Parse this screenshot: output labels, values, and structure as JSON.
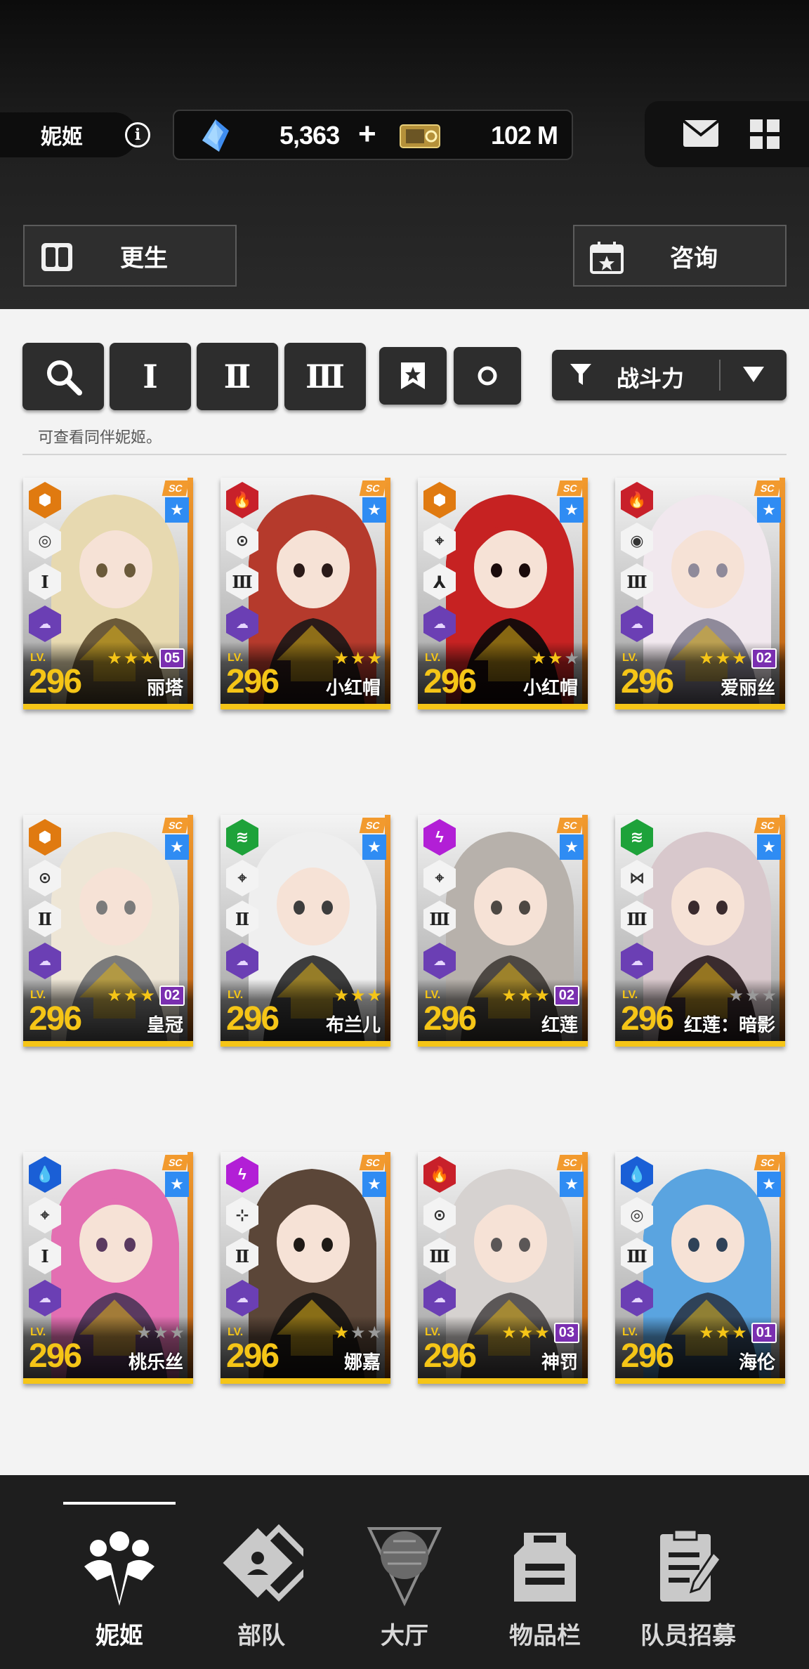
{
  "header": {
    "player_name": "妮姬",
    "info_icon": "info-icon",
    "gem_amount": "5,363",
    "gem_plus": "+",
    "credit_amount": "102 M",
    "mail_icon": "mail-icon",
    "menu_icon": "grid-icon"
  },
  "actions": {
    "rebirth_label": "更生",
    "consult_label": "咨询"
  },
  "filters": {
    "search_icon": "search-icon",
    "burst_1": "Ⅰ",
    "burst_2": "Ⅱ",
    "burst_3": "Ⅲ",
    "favorite_icon": "bookmark-star-icon",
    "circle_icon": "circle-icon",
    "sort_label": "战斗力",
    "hint": "可查看同伴妮姬。"
  },
  "lv_label": "LV.",
  "cards": [
    {
      "name": "丽塔",
      "level": "296",
      "element": "iron",
      "element_color": "#e07a10",
      "burst": "Ⅰ",
      "stars": 3,
      "limit_break": "05"
    },
    {
      "name": "小红帽",
      "level": "296",
      "element": "fire",
      "element_color": "#c8202a",
      "burst": "Ⅲ",
      "stars": 3,
      "limit_break": ""
    },
    {
      "name": "小红帽",
      "level": "296",
      "element": "iron",
      "element_color": "#e07a10",
      "burst": "⅄",
      "stars": 2,
      "limit_break": ""
    },
    {
      "name": "爱丽丝",
      "level": "296",
      "element": "fire",
      "element_color": "#c8202a",
      "burst": "Ⅲ",
      "stars": 3,
      "limit_break": "02"
    },
    {
      "name": "皇冠",
      "level": "296",
      "element": "iron",
      "element_color": "#e07a10",
      "burst": "Ⅱ",
      "stars": 3,
      "limit_break": "02"
    },
    {
      "name": "布兰儿",
      "level": "296",
      "element": "wind",
      "element_color": "#1ea23a",
      "burst": "Ⅱ",
      "stars": 3,
      "limit_break": ""
    },
    {
      "name": "红莲",
      "level": "296",
      "element": "electric",
      "element_color": "#b21fd6",
      "burst": "Ⅲ",
      "stars": 3,
      "limit_break": "02"
    },
    {
      "name": "红莲：暗影",
      "level": "296",
      "element": "wind",
      "element_color": "#1ea23a",
      "burst": "Ⅲ",
      "stars": 0,
      "limit_break": ""
    },
    {
      "name": "桃乐丝",
      "level": "296",
      "element": "water",
      "element_color": "#1a5fd6",
      "burst": "Ⅰ",
      "stars": 0,
      "limit_break": ""
    },
    {
      "name": "娜嘉",
      "level": "296",
      "element": "electric",
      "element_color": "#b21fd6",
      "burst": "Ⅱ",
      "stars": 1,
      "limit_break": ""
    },
    {
      "name": "神罚",
      "level": "296",
      "element": "fire",
      "element_color": "#c8202a",
      "burst": "Ⅲ",
      "stars": 3,
      "limit_break": "03"
    },
    {
      "name": "海伦",
      "level": "296",
      "element": "water",
      "element_color": "#1a5fd6",
      "burst": "Ⅲ",
      "stars": 3,
      "limit_break": "01"
    }
  ],
  "nav": [
    {
      "label": "妮姬",
      "icon": "nikke-icon",
      "active": true
    },
    {
      "label": "部队",
      "icon": "squad-icon",
      "active": false
    },
    {
      "label": "大厅",
      "icon": "lobby-icon",
      "active": false
    },
    {
      "label": "物品栏",
      "icon": "inventory-icon",
      "active": false
    },
    {
      "label": "队员招募",
      "icon": "recruit-icon",
      "active": false
    }
  ]
}
